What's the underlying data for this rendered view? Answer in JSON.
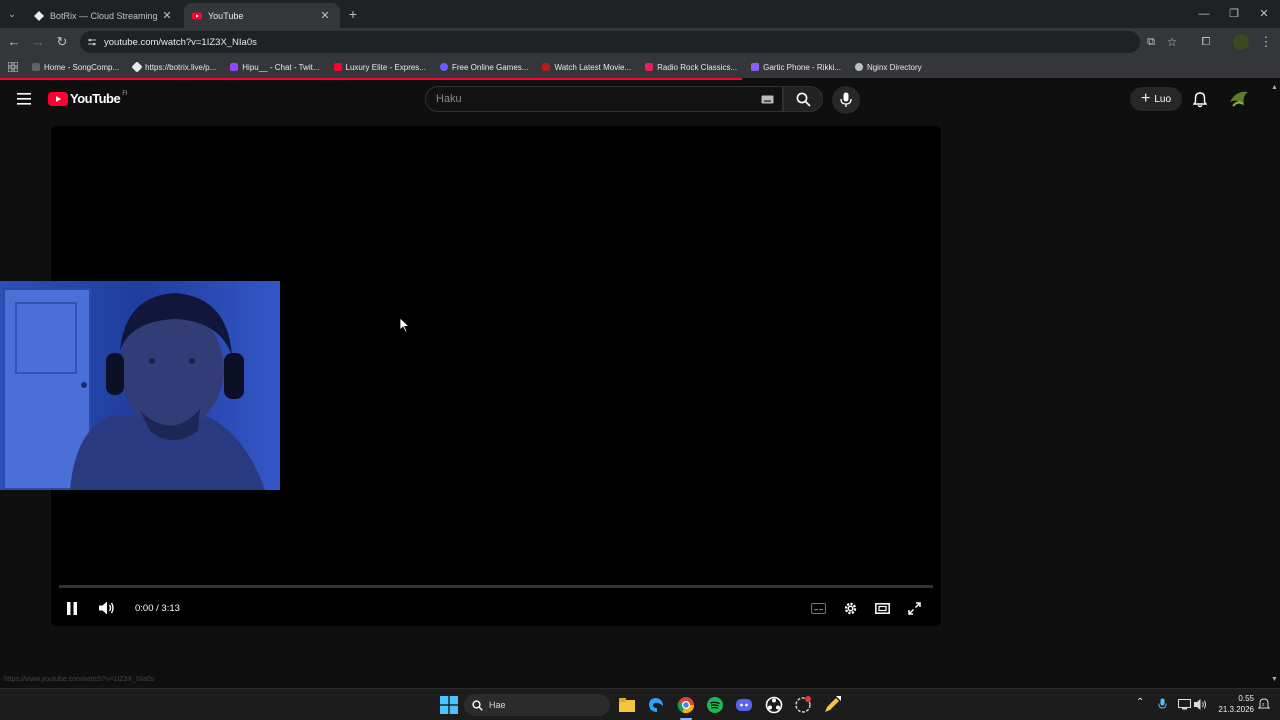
{
  "browser": {
    "tabs": [
      {
        "title": "BotRix — Cloud Streaming Bot f",
        "active": false
      },
      {
        "title": "YouTube",
        "active": true
      }
    ],
    "url": "youtube.com/watch?v=1IZ3X_NIa0s",
    "bookmarks": [
      "Home - SongComp...",
      "https://botrix.live/p...",
      "Hipu__ - Chat - Twit...",
      "Luxury Elite - Expres...",
      "Free Online Games...",
      "Watch Latest Movie...",
      "Radio Rock Classics...",
      "Gartic Phone - Rikki...",
      "Nginx Directory"
    ]
  },
  "youtube": {
    "logo_text": "YouTube",
    "region_code": "FI",
    "search_placeholder": "Haku",
    "create_label": "Luo"
  },
  "player": {
    "time": "0:00 / 3:13",
    "progress_fraction": 0.0
  },
  "status_url": "https://www.youtube.com/watch?v=1IZ3X_NIa0s",
  "taskbar": {
    "search_label": "Hae",
    "clock_time": "0.55",
    "clock_date": "21.3.2026"
  },
  "colors": {
    "yt_red": "#ff0033",
    "bg": "#0f0f0f"
  }
}
